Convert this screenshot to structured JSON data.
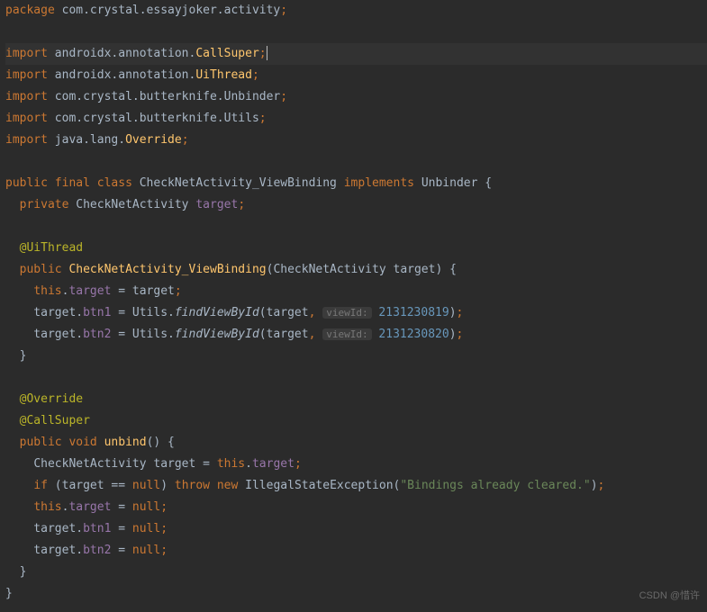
{
  "package_kw": "package",
  "package_path": "com.crystal.essayjoker.activity",
  "import_kw": "import",
  "imports": {
    "i1_pre": "androidx.annotation.",
    "i1_cls": "CallSuper",
    "i2_pre": "androidx.annotation.",
    "i2_cls": "UiThread",
    "i3_pre": "com.crystal.butterknife.",
    "i3_cls": "Unbinder",
    "i4_pre": "com.crystal.butterknife.",
    "i4_cls": "Utils",
    "i5_pre": "java.lang.",
    "i5_cls": "Override"
  },
  "kw": {
    "public": "public",
    "final": "final",
    "class": "class",
    "implements": "implements",
    "private": "private",
    "this": "this",
    "void": "void",
    "if": "if",
    "throw": "throw",
    "new": "new",
    "null": "null"
  },
  "class_decl": {
    "name": "CheckNetActivity_ViewBinding",
    "impl": "Unbinder"
  },
  "field_decl": {
    "type": "CheckNetActivity",
    "name": "target"
  },
  "anno_uithread": "@UiThread",
  "anno_override": "@Override",
  "anno_callsuper": "@CallSuper",
  "ctor": {
    "name": "CheckNetActivity_ViewBinding",
    "param_type": "CheckNetActivity",
    "param_name": "target"
  },
  "assign": {
    "this_target": "target",
    "eq": " = ",
    "target_local": "target",
    "btn1": "btn1",
    "btn2": "btn2",
    "utils": "Utils",
    "findViewById": "findViewById",
    "hint": "viewId:",
    "id1": "2131230819",
    "id2": "2131230820"
  },
  "unbind": {
    "name": "unbind",
    "local_type": "CheckNetActivity",
    "local_name": "target",
    "this_target": "target",
    "cond": "target == ",
    "exc": "IllegalStateException",
    "msg": "\"Bindings already cleared.\""
  },
  "watermark": "CSDN @惜许"
}
